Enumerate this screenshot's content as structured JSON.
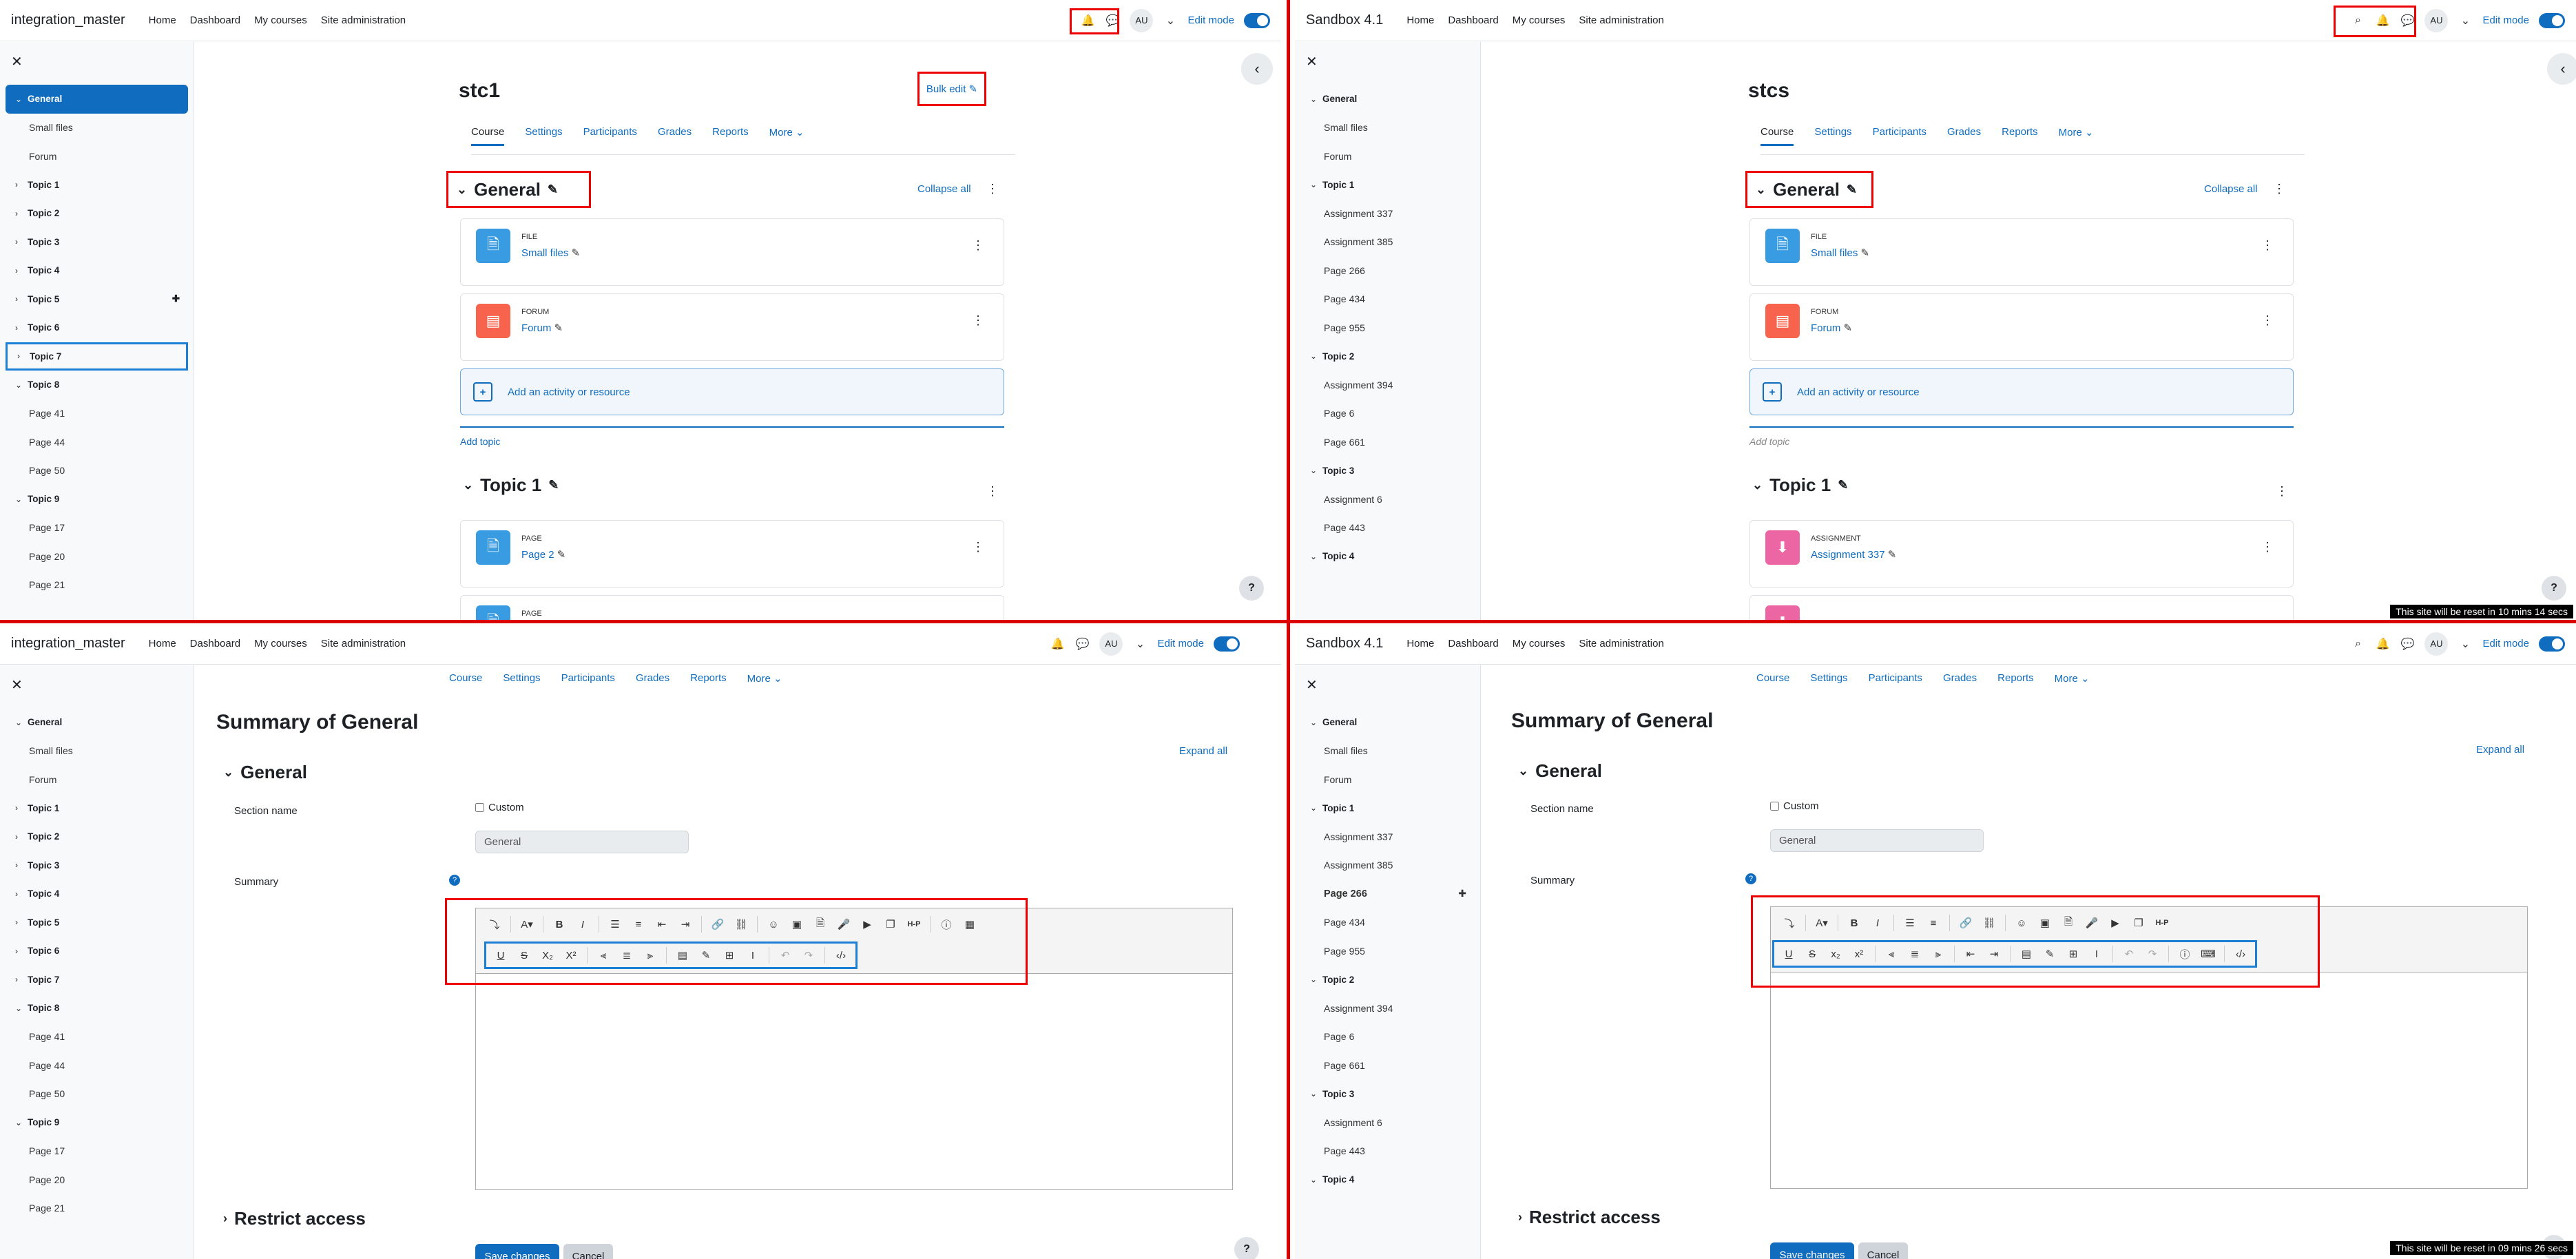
{
  "q1": {
    "brand": "integration_master",
    "nav": [
      "Home",
      "Dashboard",
      "My courses",
      "Site administration"
    ],
    "avatar": "AU",
    "edit_mode": "Edit mode",
    "drawer": [
      {
        "label": "General",
        "kind": "sel"
      },
      {
        "label": "Small files",
        "kind": "sub"
      },
      {
        "label": "Forum",
        "kind": "sub"
      },
      {
        "label": "Topic 1",
        "kind": "sec"
      },
      {
        "label": "Topic 2",
        "kind": "sec"
      },
      {
        "label": "Topic 3",
        "kind": "sec"
      },
      {
        "label": "Topic 4",
        "kind": "sec"
      },
      {
        "label": "Topic 5",
        "kind": "sec"
      },
      {
        "label": "Topic 6",
        "kind": "sec"
      },
      {
        "label": "Topic 7",
        "kind": "box"
      },
      {
        "label": "Topic 8",
        "kind": "act"
      },
      {
        "label": "Page 41",
        "kind": "sub"
      },
      {
        "label": "Page 44",
        "kind": "sub"
      },
      {
        "label": "Page 50",
        "kind": "sub"
      },
      {
        "label": "Topic 9",
        "kind": "act"
      },
      {
        "label": "Page 17",
        "kind": "sub"
      },
      {
        "label": "Page 20",
        "kind": "sub"
      },
      {
        "label": "Page 21",
        "kind": "sub"
      }
    ],
    "course_title": "stc1",
    "bulk_edit": "Bulk edit",
    "tabs": [
      "Course",
      "Settings",
      "Participants",
      "Grades",
      "Reports",
      "More"
    ],
    "section": "General",
    "collapse_all": "Collapse all",
    "act1_type": "FILE",
    "act1_name": "Small files",
    "act2_type": "FORUM",
    "act2_name": "Forum",
    "add_activity": "Add an activity or resource",
    "add_topic": "Add topic",
    "section2": "Topic 1",
    "act3_type": "PAGE",
    "act3_name": "Page 2",
    "act4_type": "PAGE"
  },
  "q2": {
    "brand": "Sandbox 4.1",
    "nav": [
      "Home",
      "Dashboard",
      "My courses",
      "Site administration"
    ],
    "avatar": "AU",
    "edit_mode": "Edit mode",
    "drawer": [
      {
        "label": "General",
        "kind": "act"
      },
      {
        "label": "Small files",
        "kind": "sub"
      },
      {
        "label": "Forum",
        "kind": "sub"
      },
      {
        "label": "Topic 1",
        "kind": "act"
      },
      {
        "label": "Assignment 337",
        "kind": "sub"
      },
      {
        "label": "Assignment 385",
        "kind": "sub"
      },
      {
        "label": "Page 266",
        "kind": "sub"
      },
      {
        "label": "Page 434",
        "kind": "sub"
      },
      {
        "label": "Page 955",
        "kind": "sub"
      },
      {
        "label": "Topic 2",
        "kind": "act"
      },
      {
        "label": "Assignment 394",
        "kind": "sub"
      },
      {
        "label": "Page 6",
        "kind": "sub"
      },
      {
        "label": "Page 661",
        "kind": "sub"
      },
      {
        "label": "Topic 3",
        "kind": "act"
      },
      {
        "label": "Assignment 6",
        "kind": "sub"
      },
      {
        "label": "Page 443",
        "kind": "sub"
      },
      {
        "label": "Topic 4",
        "kind": "act"
      }
    ],
    "course_title": "stcs",
    "tabs": [
      "Course",
      "Settings",
      "Participants",
      "Grades",
      "Reports",
      "More"
    ],
    "section": "General",
    "collapse_all": "Collapse all",
    "act1_type": "FILE",
    "act1_name": "Small files",
    "act2_type": "FORUM",
    "act2_name": "Forum",
    "add_activity": "Add an activity or resource",
    "add_topic": "Add topic",
    "section2": "Topic 1",
    "act3_type": "ASSIGNMENT",
    "act3_name": "Assignment 337",
    "reset": "This site will be reset in 10 mins 14 secs"
  },
  "q3": {
    "brand": "integration_master",
    "nav": [
      "Home",
      "Dashboard",
      "My courses",
      "Site administration"
    ],
    "avatar": "AU",
    "edit_mode": "Edit mode",
    "drawer": [
      {
        "label": "General",
        "kind": "act"
      },
      {
        "label": "Small files",
        "kind": "sub"
      },
      {
        "label": "Forum",
        "kind": "sub"
      },
      {
        "label": "Topic 1",
        "kind": "sec"
      },
      {
        "label": "Topic 2",
        "kind": "sec"
      },
      {
        "label": "Topic 3",
        "kind": "sec"
      },
      {
        "label": "Topic 4",
        "kind": "sec"
      },
      {
        "label": "Topic 5",
        "kind": "sec"
      },
      {
        "label": "Topic 6",
        "kind": "sec"
      },
      {
        "label": "Topic 7",
        "kind": "sec"
      },
      {
        "label": "Topic 8",
        "kind": "act"
      },
      {
        "label": "Page 41",
        "kind": "sub"
      },
      {
        "label": "Page 44",
        "kind": "sub"
      },
      {
        "label": "Page 50",
        "kind": "sub"
      },
      {
        "label": "Topic 9",
        "kind": "act"
      },
      {
        "label": "Page 17",
        "kind": "sub"
      },
      {
        "label": "Page 20",
        "kind": "sub"
      },
      {
        "label": "Page 21",
        "kind": "sub"
      }
    ],
    "tabs": [
      "Course",
      "Settings",
      "Participants",
      "Grades",
      "Reports",
      "More"
    ],
    "page_title": "Summary of General",
    "expand_all": "Expand all",
    "fieldset": "General",
    "section_name_label": "Section name",
    "custom_label": "Custom",
    "section_name_value": "General",
    "summary_label": "Summary",
    "restrict": "Restrict access",
    "save": "Save changes",
    "cancel": "Cancel"
  },
  "q4": {
    "brand": "Sandbox 4.1",
    "nav": [
      "Home",
      "Dashboard",
      "My courses",
      "Site administration"
    ],
    "avatar": "AU",
    "edit_mode": "Edit mode",
    "drawer": [
      {
        "label": "General",
        "kind": "act"
      },
      {
        "label": "Small files",
        "kind": "sub"
      },
      {
        "label": "Forum",
        "kind": "sub"
      },
      {
        "label": "Topic 1",
        "kind": "act"
      },
      {
        "label": "Assignment 337",
        "kind": "sub"
      },
      {
        "label": "Assignment 385",
        "kind": "sub"
      },
      {
        "label": "Page 266",
        "kind": "subb"
      },
      {
        "label": "Page 434",
        "kind": "sub"
      },
      {
        "label": "Page 955",
        "kind": "sub"
      },
      {
        "label": "Topic 2",
        "kind": "act"
      },
      {
        "label": "Assignment 394",
        "kind": "sub"
      },
      {
        "label": "Page 6",
        "kind": "sub"
      },
      {
        "label": "Page 661",
        "kind": "sub"
      },
      {
        "label": "Topic 3",
        "kind": "act"
      },
      {
        "label": "Assignment 6",
        "kind": "sub"
      },
      {
        "label": "Page 443",
        "kind": "sub"
      },
      {
        "label": "Topic 4",
        "kind": "act"
      }
    ],
    "tabs": [
      "Course",
      "Settings",
      "Participants",
      "Grades",
      "Reports",
      "More"
    ],
    "page_title": "Summary of General",
    "expand_all": "Expand all",
    "fieldset": "General",
    "section_name_label": "Section name",
    "custom_label": "Custom",
    "section_name_value": "General",
    "summary_label": "Summary",
    "restrict": "Restrict access",
    "save": "Save changes",
    "cancel": "Cancel",
    "reset": "This site will be reset in 09 mins 26 secs"
  },
  "icons": {
    "colors": {
      "file": "#399be2",
      "forum": "#f7634d",
      "page": "#399be2",
      "assignment": "#eb66a2",
      "accent": "#0f6cbf"
    }
  }
}
